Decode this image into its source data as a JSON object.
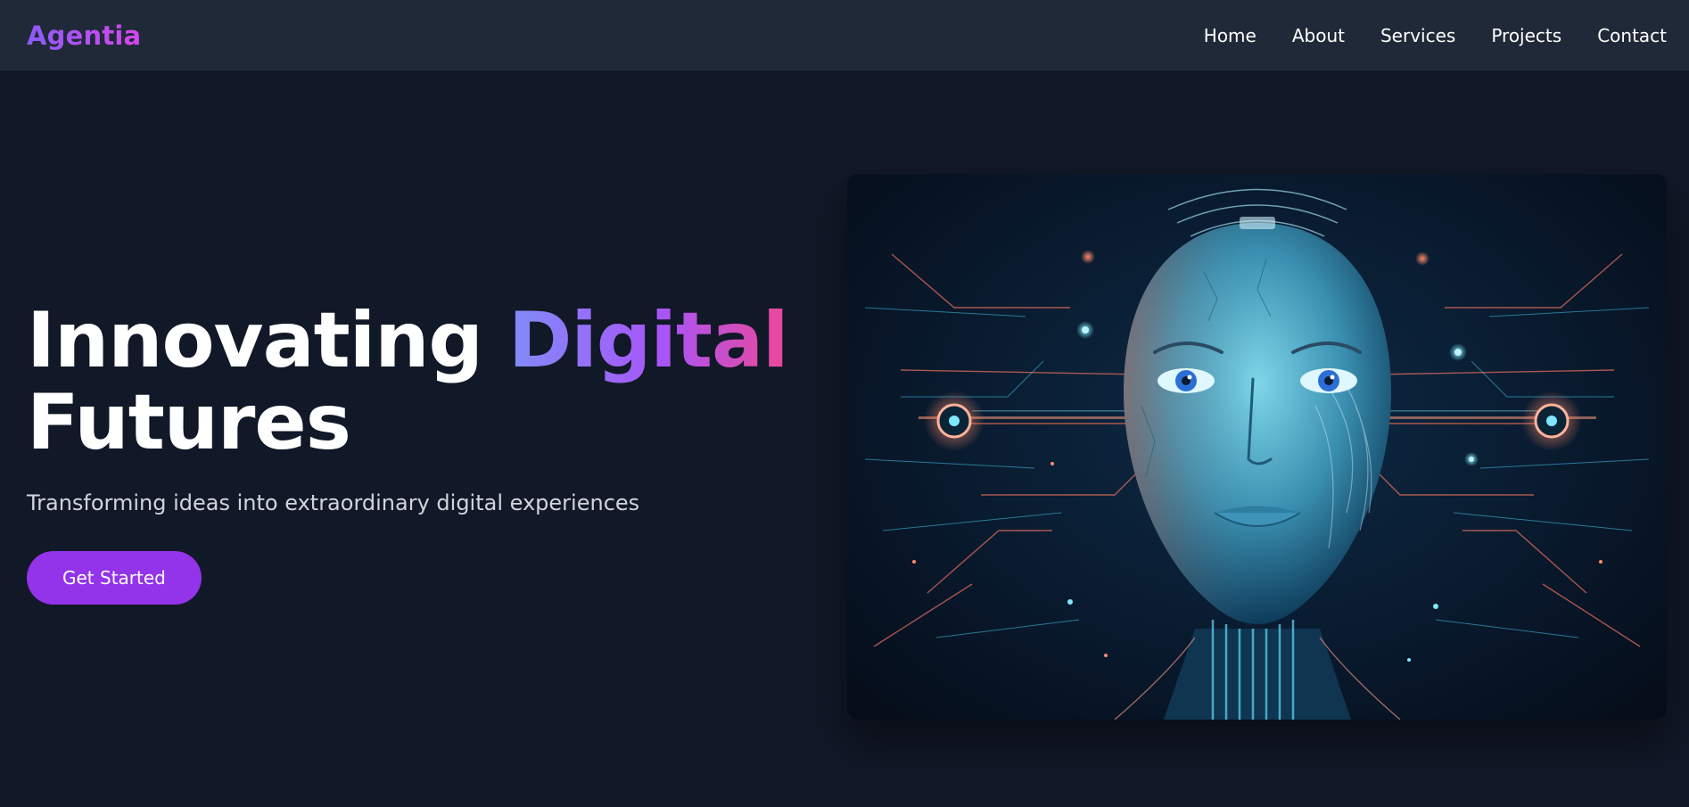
{
  "brand": {
    "name": "Agentia"
  },
  "nav": {
    "items": [
      {
        "label": "Home"
      },
      {
        "label": "About"
      },
      {
        "label": "Services"
      },
      {
        "label": "Projects"
      },
      {
        "label": "Contact"
      }
    ]
  },
  "hero": {
    "title_main": "Innovating ",
    "title_accent": "Digital",
    "title_line2": "Futures",
    "subtitle": "Transforming ideas into extraordinary digital experiences",
    "cta_label": "Get Started",
    "image_alt": "ai-cyborg-face-illustration"
  },
  "colors": {
    "nav_bg": "#1f2937",
    "page_bg": "#111827",
    "accent_purple": "#9333ea",
    "gradient_start": "#818cf8",
    "gradient_end": "#ec4899"
  }
}
